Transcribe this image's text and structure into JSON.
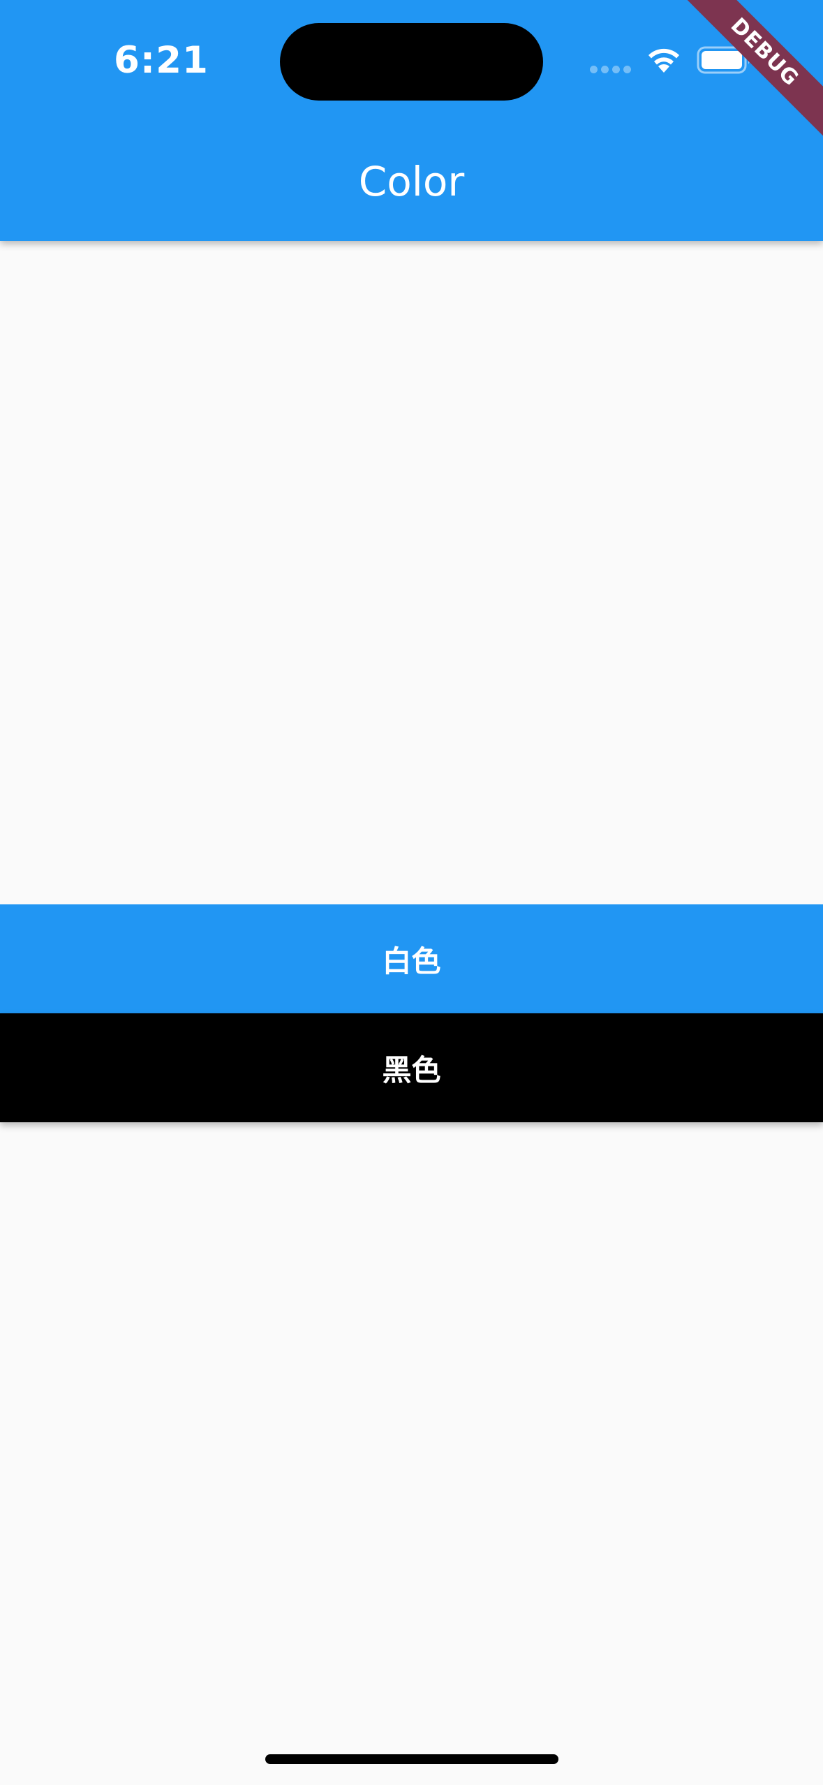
{
  "status_bar": {
    "time": "6:21",
    "icons": [
      "signal-dots-icon",
      "wifi-icon",
      "battery-icon"
    ]
  },
  "app_bar": {
    "title": "Color",
    "background_color": "#2196F3"
  },
  "debug_banner": {
    "label": "DEBUG",
    "color": "#7D3450"
  },
  "buttons": [
    {
      "label": "白色",
      "background_color": "#2196F3"
    },
    {
      "label": "黑色",
      "background_color": "#000000"
    }
  ]
}
